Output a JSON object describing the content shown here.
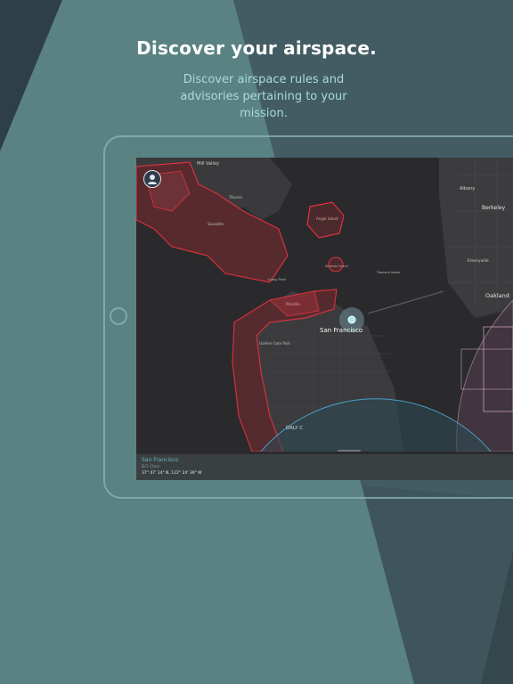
{
  "headline": "Discover your airspace.",
  "subhead": "Discover airspace rules and advisories pertaining to your mission.",
  "map": {
    "labels": {
      "mill_valley": "Mill Valley",
      "albany": "Albany",
      "berkeley": "Berkeley",
      "emeryville": "Emeryville",
      "oakland": "Oakland",
      "san_francisco": "San Francisco",
      "presidio": "Presidio",
      "golden_gate_park": "Golden Gate Park",
      "daly_city": "DALY C",
      "tiburon": "Tiburon",
      "angel_island": "Angel Island",
      "alcatraz": "Alcatraz Island",
      "treasure_island": "Treasure Island",
      "crissy_field": "Crissy Field",
      "sausalito": "Sausalito"
    },
    "accent_restricted": "#e0323f",
    "accent_circle": "#4a9ec2",
    "accent_classb": "#c99ab9"
  },
  "panel": {
    "location": "San Francisco",
    "airspace_class": "B/1 Class",
    "coordinates": "37° 47' 14\" N, 122° 24' 39\" W"
  },
  "icons": {
    "avatar": "user-avatar-icon",
    "location": "location-marker-icon"
  }
}
